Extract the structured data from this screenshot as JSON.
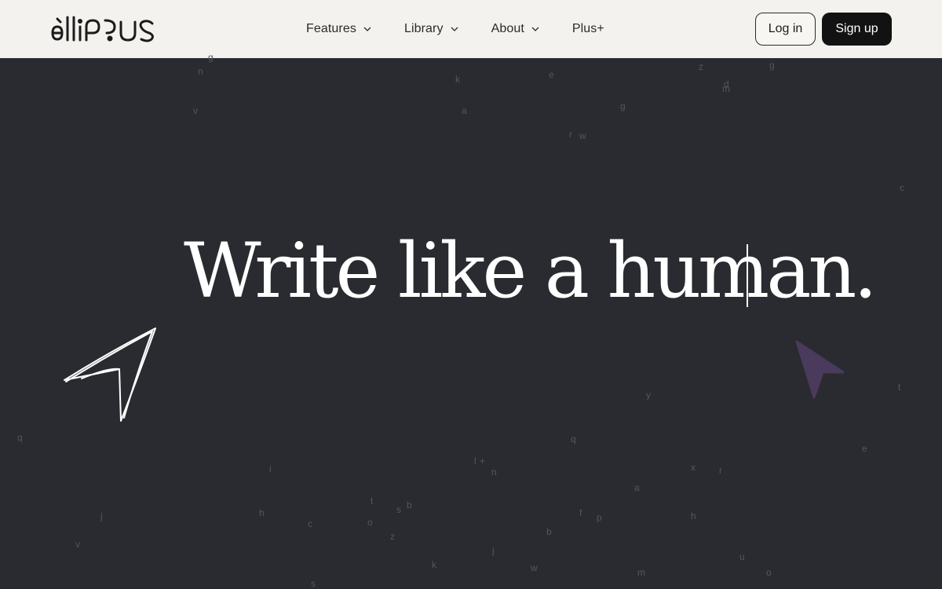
{
  "header": {
    "logo_text": "ellipsus",
    "nav": [
      {
        "label": "Features",
        "has_dropdown": true
      },
      {
        "label": "Library",
        "has_dropdown": true
      },
      {
        "label": "About",
        "has_dropdown": true
      },
      {
        "label": "Plus+",
        "has_dropdown": false
      }
    ],
    "login_label": "Log in",
    "signup_label": "Sign up"
  },
  "hero": {
    "title": "Write like a human."
  },
  "scattered_letters": [
    "g",
    "n",
    "k",
    "e",
    "z",
    "g",
    "m",
    "v",
    "a",
    "g",
    "d",
    "r",
    "w",
    "c",
    "y",
    "t",
    "q",
    "q",
    "i",
    "l",
    "+",
    "n",
    "x",
    "r",
    "e",
    "t",
    "s",
    "b",
    "a",
    "j",
    "h",
    "c",
    "o",
    "f",
    "p",
    "h",
    "z",
    "b",
    "v",
    "k",
    "j",
    "w",
    "m",
    "u",
    "o",
    "s"
  ],
  "colors": {
    "background": "#2a2b30",
    "header_bg": "#f3f2ef",
    "signup_bg": "#121212",
    "cursor_purple": "#4a3a5c"
  }
}
